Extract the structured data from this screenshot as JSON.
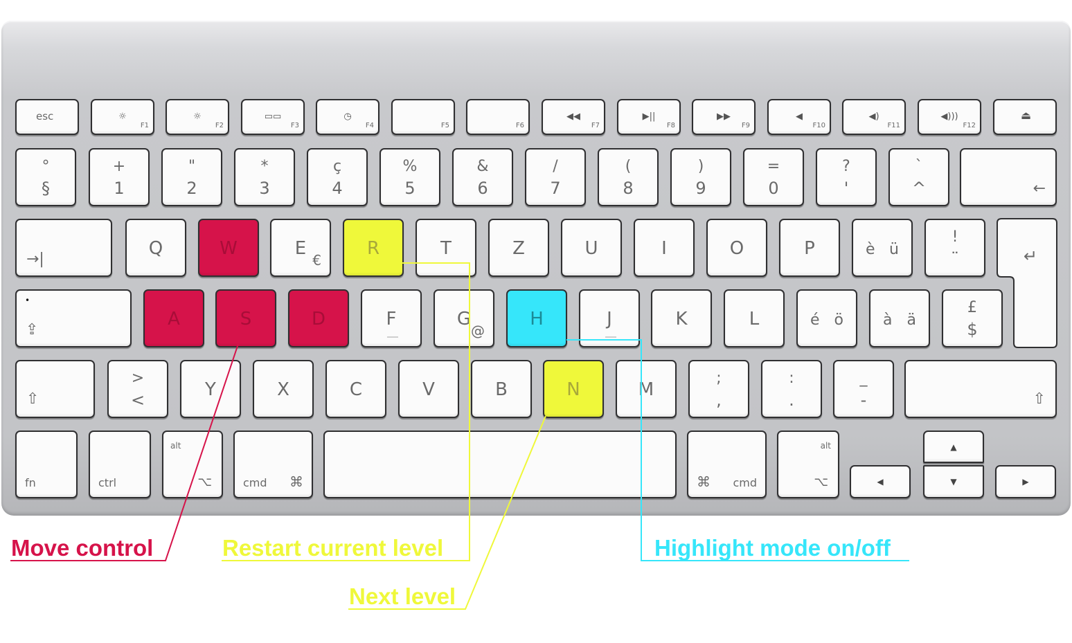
{
  "colors": {
    "move": "#d6134a",
    "restart": "#eff83a",
    "highlight": "#36e6fa"
  },
  "annotations": {
    "move_control": "Move control",
    "restart_level": "Restart current level",
    "next_level": "Next level",
    "highlight_mode": "Highlight mode on/off"
  },
  "rows": [
    [
      {
        "id": "esc",
        "legends": [
          "esc"
        ]
      },
      {
        "id": "f1",
        "legends": [
          "☼",
          "F1"
        ],
        "icon": "brightness-down-icon"
      },
      {
        "id": "f2",
        "legends": [
          "☼",
          "F2"
        ],
        "icon": "brightness-up-icon"
      },
      {
        "id": "f3",
        "legends": [
          "▭▭",
          "F3"
        ],
        "icon": "mission-control-icon"
      },
      {
        "id": "f4",
        "legends": [
          "◷",
          "F4"
        ],
        "icon": "dashboard-icon"
      },
      {
        "id": "f5",
        "legends": [
          "F5"
        ]
      },
      {
        "id": "f6",
        "legends": [
          "F6"
        ]
      },
      {
        "id": "f7",
        "legends": [
          "◀◀",
          "F7"
        ],
        "icon": "rewind-icon"
      },
      {
        "id": "f8",
        "legends": [
          "▶||",
          "F8"
        ],
        "icon": "play-pause-icon"
      },
      {
        "id": "f9",
        "legends": [
          "▶▶",
          "F9"
        ],
        "icon": "fast-forward-icon"
      },
      {
        "id": "f10",
        "legends": [
          "◀",
          "F10"
        ],
        "icon": "mute-icon"
      },
      {
        "id": "f11",
        "legends": [
          "◀)",
          "F11"
        ],
        "icon": "volume-down-icon"
      },
      {
        "id": "f12",
        "legends": [
          "◀)))",
          "F12"
        ],
        "icon": "volume-up-icon"
      },
      {
        "id": "eject",
        "legends": [
          "⏏"
        ],
        "icon": "eject-icon"
      }
    ],
    [
      {
        "id": "section",
        "legends": [
          "°",
          "§"
        ]
      },
      {
        "id": "1",
        "legends": [
          "+",
          "1"
        ]
      },
      {
        "id": "2",
        "legends": [
          "\"",
          "2"
        ]
      },
      {
        "id": "3",
        "legends": [
          "*",
          "3"
        ]
      },
      {
        "id": "4",
        "legends": [
          "ç",
          "4"
        ]
      },
      {
        "id": "5",
        "legends": [
          "%",
          "5"
        ]
      },
      {
        "id": "6",
        "legends": [
          "&",
          "6"
        ]
      },
      {
        "id": "7",
        "legends": [
          "/",
          "7"
        ]
      },
      {
        "id": "8",
        "legends": [
          "(",
          "8"
        ]
      },
      {
        "id": "9",
        "legends": [
          ")",
          "9"
        ]
      },
      {
        "id": "0",
        "legends": [
          "=",
          "0"
        ]
      },
      {
        "id": "apos",
        "legends": [
          "?",
          "'"
        ]
      },
      {
        "id": "caret",
        "legends": [
          "`",
          "^"
        ]
      },
      {
        "id": "backspace",
        "legends": [
          "←"
        ],
        "icon": "backspace-icon"
      }
    ],
    [
      {
        "id": "tab",
        "legends": [
          "→|"
        ],
        "icon": "tab-icon"
      },
      {
        "id": "q",
        "legends": [
          "Q"
        ]
      },
      {
        "id": "w",
        "legends": [
          "W"
        ],
        "hl": "move"
      },
      {
        "id": "e",
        "legends": [
          "E",
          "€"
        ]
      },
      {
        "id": "r",
        "legends": [
          "R"
        ],
        "hl": "restart"
      },
      {
        "id": "t",
        "legends": [
          "T"
        ]
      },
      {
        "id": "z",
        "legends": [
          "Z"
        ]
      },
      {
        "id": "u",
        "legends": [
          "U"
        ]
      },
      {
        "id": "i",
        "legends": [
          "I"
        ]
      },
      {
        "id": "o",
        "legends": [
          "O"
        ]
      },
      {
        "id": "p",
        "legends": [
          "P"
        ]
      },
      {
        "id": "egrave",
        "legends": [
          "è",
          "ü"
        ]
      },
      {
        "id": "excl",
        "legends": [
          "!",
          "¨"
        ]
      },
      {
        "id": "return",
        "legends": [
          "↵"
        ],
        "icon": "return-icon"
      }
    ],
    [
      {
        "id": "capslock",
        "legends": [
          "•",
          "⇪"
        ],
        "icon": "caps-lock-icon"
      },
      {
        "id": "a",
        "legends": [
          "A"
        ],
        "hl": "move"
      },
      {
        "id": "s",
        "legends": [
          "S"
        ],
        "hl": "move"
      },
      {
        "id": "d",
        "legends": [
          "D"
        ],
        "hl": "move"
      },
      {
        "id": "f",
        "legends": [
          "F"
        ]
      },
      {
        "id": "g",
        "legends": [
          "G",
          "@"
        ]
      },
      {
        "id": "h",
        "legends": [
          "H"
        ],
        "hl": "highlight"
      },
      {
        "id": "j",
        "legends": [
          "J"
        ]
      },
      {
        "id": "k",
        "legends": [
          "K"
        ]
      },
      {
        "id": "l",
        "legends": [
          "L"
        ]
      },
      {
        "id": "eacute",
        "legends": [
          "é",
          "ö"
        ]
      },
      {
        "id": "agrave",
        "legends": [
          "à",
          "ä"
        ]
      },
      {
        "id": "pound",
        "legends": [
          "£",
          "$"
        ]
      }
    ],
    [
      {
        "id": "lshift",
        "legends": [
          "⇧"
        ],
        "icon": "shift-icon"
      },
      {
        "id": "less",
        "legends": [
          ">",
          "<"
        ]
      },
      {
        "id": "y",
        "legends": [
          "Y"
        ]
      },
      {
        "id": "x",
        "legends": [
          "X"
        ]
      },
      {
        "id": "c",
        "legends": [
          "C"
        ]
      },
      {
        "id": "v",
        "legends": [
          "V"
        ]
      },
      {
        "id": "b",
        "legends": [
          "B"
        ]
      },
      {
        "id": "n",
        "legends": [
          "N"
        ],
        "hl": "restart"
      },
      {
        "id": "m",
        "legends": [
          "M"
        ]
      },
      {
        "id": "comma",
        "legends": [
          ";",
          ","
        ]
      },
      {
        "id": "period",
        "legends": [
          ":",
          "."
        ]
      },
      {
        "id": "minus",
        "legends": [
          "_",
          "-"
        ]
      },
      {
        "id": "rshift",
        "legends": [
          "⇧"
        ],
        "icon": "shift-icon"
      }
    ],
    [
      {
        "id": "fn",
        "legends": [
          "fn"
        ]
      },
      {
        "id": "ctrl",
        "legends": [
          "ctrl"
        ]
      },
      {
        "id": "lalt",
        "legends": [
          "alt",
          "⌥"
        ]
      },
      {
        "id": "lcmd",
        "legends": [
          "cmd",
          "⌘"
        ]
      },
      {
        "id": "space",
        "legends": []
      },
      {
        "id": "rcmd",
        "legends": [
          "⌘",
          "cmd"
        ]
      },
      {
        "id": "ralt",
        "legends": [
          "alt",
          "⌥"
        ]
      },
      {
        "id": "left",
        "legends": [
          "◀"
        ],
        "icon": "arrow-left-icon"
      },
      {
        "id": "up",
        "legends": [
          "▲"
        ],
        "icon": "arrow-up-icon"
      },
      {
        "id": "down",
        "legends": [
          "▼"
        ],
        "icon": "arrow-down-icon"
      },
      {
        "id": "right",
        "legends": [
          "▶"
        ],
        "icon": "arrow-right-icon"
      }
    ]
  ]
}
